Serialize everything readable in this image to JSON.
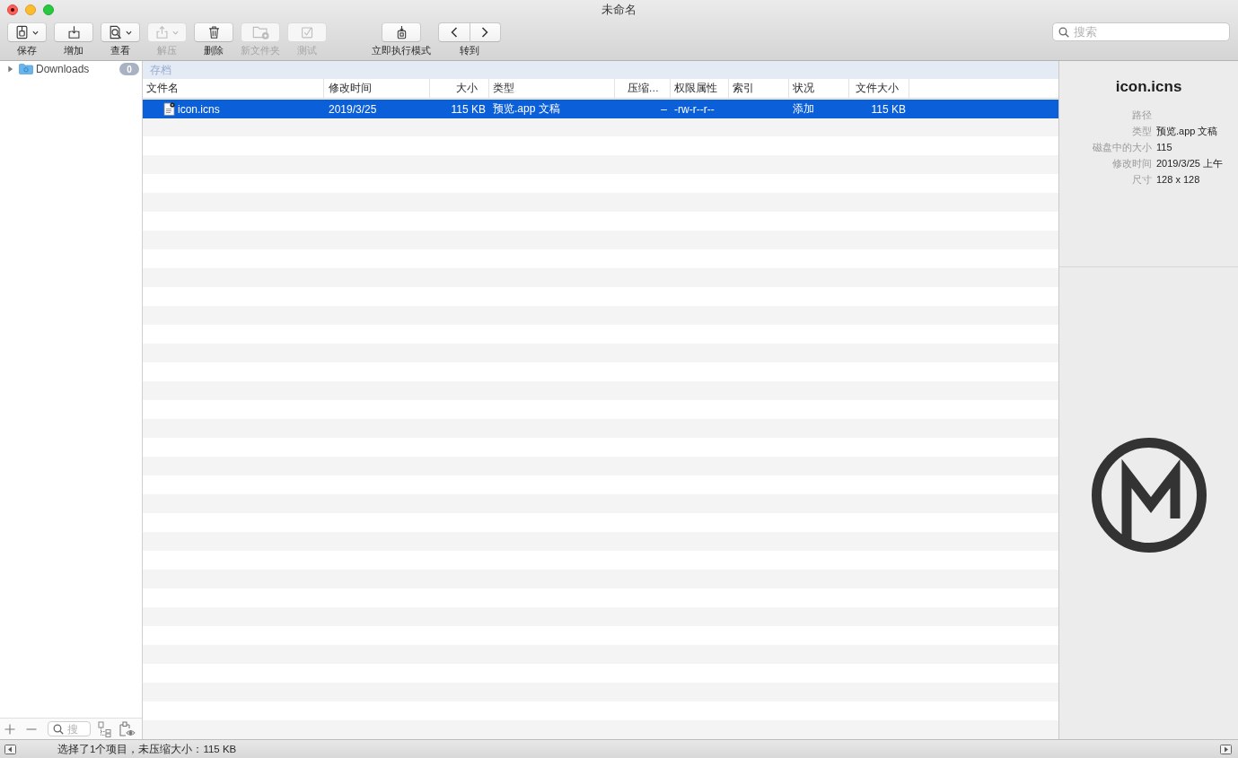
{
  "window": {
    "title": "未命名",
    "unsaved": true
  },
  "toolbar": {
    "items": [
      {
        "label": "保存",
        "dropdown": true,
        "disabled": false
      },
      {
        "label": "增加",
        "dropdown": false,
        "disabled": false
      },
      {
        "label": "查看",
        "dropdown": true,
        "disabled": false
      },
      {
        "label": "解压",
        "dropdown": true,
        "disabled": true
      },
      {
        "label": "删除",
        "dropdown": false,
        "disabled": false
      },
      {
        "label": "新文件夹",
        "dropdown": false,
        "disabled": true
      },
      {
        "label": "测试",
        "dropdown": false,
        "disabled": true
      }
    ],
    "mode_button": {
      "label": "立即执行模式"
    },
    "navigation": {
      "label": "转到"
    },
    "search": {
      "placeholder": "搜索"
    }
  },
  "sidebar": {
    "items": [
      {
        "label": "Downloads",
        "count": "0",
        "expanded": false,
        "selected": false
      }
    ],
    "filter": {
      "placeholder": "搜"
    }
  },
  "table": {
    "path": "存档",
    "columns": [
      "文件名",
      "修改时间",
      "大小",
      "类型",
      "压缩…",
      "权限属性",
      "索引",
      "状况",
      "文件大小"
    ],
    "rows": [
      {
        "selected": true,
        "file_name": "icon.icns",
        "modified": "2019/3/25",
        "size": "115 KB",
        "type": "预览.app 文稿",
        "compressed": "–",
        "permissions": "-rw-r--r--",
        "status": "添加",
        "file_size": "115 KB"
      }
    ]
  },
  "inspector": {
    "title": "icon.icns",
    "properties": [
      {
        "label": "路径"
      },
      {
        "label": "类型",
        "value": "预览.app 文稿"
      },
      {
        "label": "磁盘中的大小",
        "value": "115"
      },
      {
        "label": "修改时间",
        "value": "2019/3/25 上午"
      },
      {
        "label": "尺寸",
        "value": "128 x 128"
      }
    ]
  },
  "status_bar": {
    "text": "选择了1个项目，未压缩大小：115 KB"
  }
}
